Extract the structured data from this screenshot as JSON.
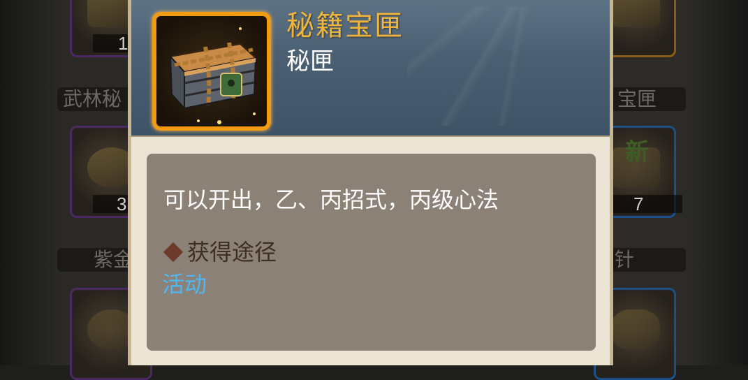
{
  "background": {
    "slot_counts": [
      "1",
      "3",
      "7"
    ],
    "slot_names": [
      "武林秘",
      "宝匣",
      "紫金",
      "针"
    ],
    "badge_text": "新"
  },
  "tooltip": {
    "title": "秘籍宝匣",
    "type": "秘匣",
    "icon": "locked-treasure-chest-icon",
    "description": "可以开出，乙、丙招式，丙级心法",
    "source_heading": "获得途径",
    "source_link": "活动"
  },
  "colors": {
    "title": "#f0b53d",
    "link": "#4fb7f2",
    "header": "#4b6073",
    "icon_border": "#f19a13"
  }
}
